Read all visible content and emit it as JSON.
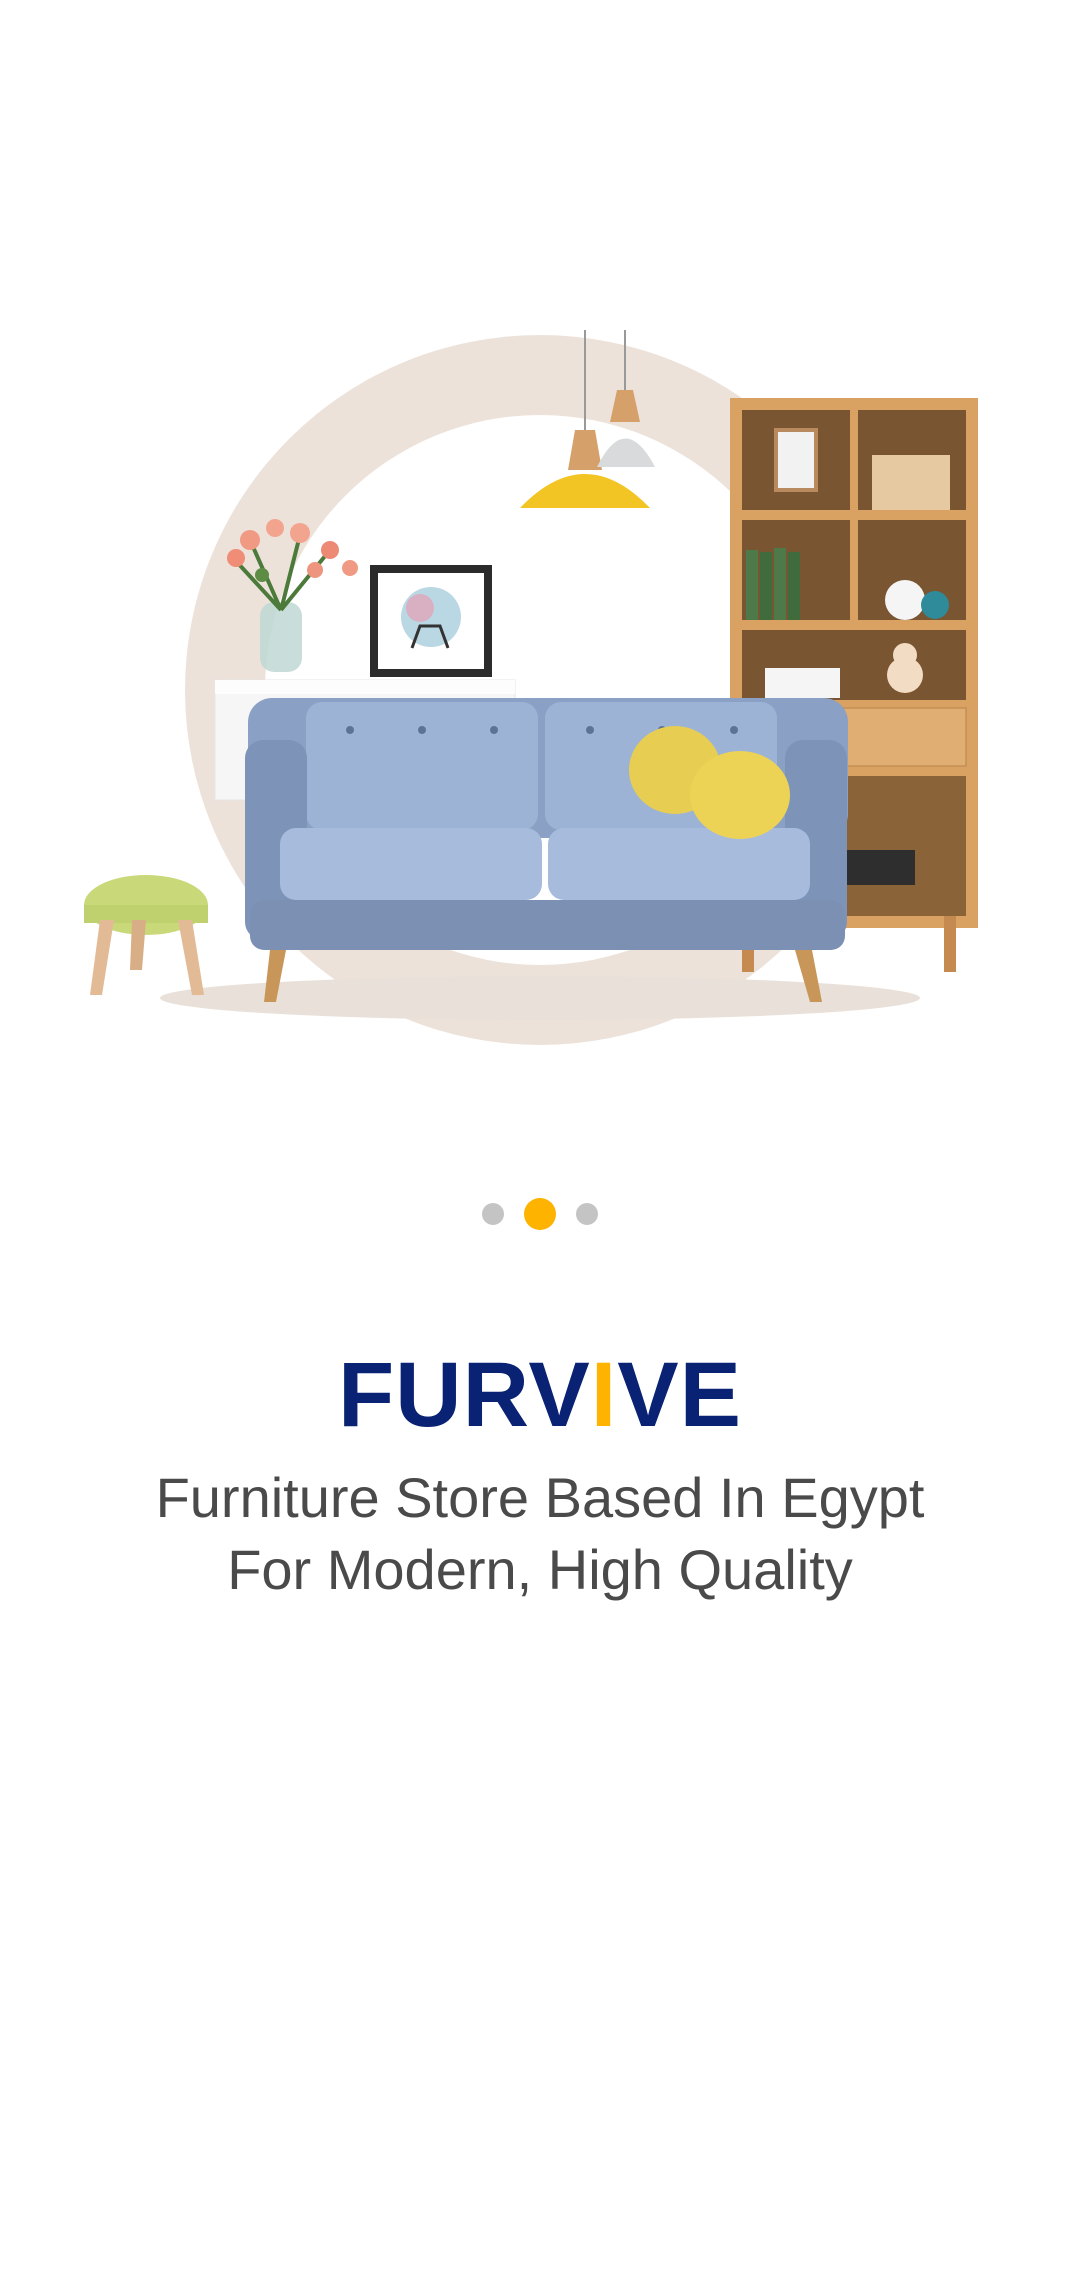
{
  "hero": {
    "illustration": "living-room-furniture"
  },
  "pager": {
    "count": 3,
    "active_index": 1,
    "active_color": "#FDB300",
    "inactive_color": "#C4C4C4"
  },
  "brand": {
    "part1": "FURV",
    "accent": "I",
    "part2": "VE",
    "color": "#0A2274",
    "accent_color": "#FDB300"
  },
  "tagline": {
    "line1": "Furniture Store Based In Egypt",
    "line2": "For Modern, High Quality"
  }
}
